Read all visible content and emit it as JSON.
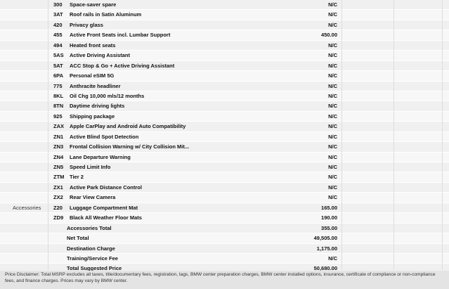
{
  "options": [
    {
      "category": "",
      "code": "300",
      "description": "Space-saver spare",
      "price": "N/C"
    },
    {
      "category": "",
      "code": "3AT",
      "description": "Roof rails in Satin Aluminum",
      "price": "N/C"
    },
    {
      "category": "",
      "code": "420",
      "description": "Privacy glass",
      "price": "N/C"
    },
    {
      "category": "",
      "code": "455",
      "description": "Active Front Seats incl. Lumbar Support",
      "price": "450.00"
    },
    {
      "category": "",
      "code": "494",
      "description": "Heated front seats",
      "price": "N/C"
    },
    {
      "category": "",
      "code": "5AS",
      "description": "Active Driving Assistant",
      "price": "N/C"
    },
    {
      "category": "",
      "code": "5AT",
      "description": "ACC Stop & Go + Active Driving Assistant",
      "price": "N/C"
    },
    {
      "category": "",
      "code": "6PA",
      "description": "Personal eSIM 5G",
      "price": "N/C"
    },
    {
      "category": "",
      "code": "775",
      "description": "Anthracite headliner",
      "price": "N/C"
    },
    {
      "category": "",
      "code": "8KL",
      "description": "Oil Chg 10,000 mls/12 months",
      "price": "N/C"
    },
    {
      "category": "",
      "code": "8TN",
      "description": "Daytime driving lights",
      "price": "N/C"
    },
    {
      "category": "",
      "code": "925",
      "description": "Shipping package",
      "price": "N/C"
    },
    {
      "category": "",
      "code": "ZAX",
      "description": "Apple CarPlay and Android Auto Compatibility",
      "price": "N/C"
    },
    {
      "category": "",
      "code": "ZN1",
      "description": "Active Blind Spot Detection",
      "price": "N/C"
    },
    {
      "category": "",
      "code": "ZN3",
      "description": "Frontal Collision Warning w/ City Collision Mit...",
      "price": "N/C"
    },
    {
      "category": "",
      "code": "ZN4",
      "description": "Lane Departure Warning",
      "price": "N/C"
    },
    {
      "category": "",
      "code": "ZN5",
      "description": "Speed Limit Info",
      "price": "N/C"
    },
    {
      "category": "",
      "code": "ZTM",
      "description": "Tier 2",
      "price": "N/C"
    },
    {
      "category": "",
      "code": "ZX1",
      "description": "Active Park Distance Control",
      "price": "N/C"
    },
    {
      "category": "",
      "code": "ZX2",
      "description": "Rear View Camera",
      "price": "N/C"
    },
    {
      "category": "Accessories",
      "code": "Z20",
      "description": "Luggage Compartment Mat",
      "price": "165.00"
    },
    {
      "category": "",
      "code": "ZD9",
      "description": "Black All Weather Floor Mats",
      "price": "190.00"
    }
  ],
  "totals": [
    {
      "label": "Accessories Total",
      "value": "355.00"
    },
    {
      "label": "Net Total",
      "value": "49,505.00"
    },
    {
      "label": "Destination Charge",
      "value": "1,175.00"
    },
    {
      "label": "Training/Service Fee",
      "value": "N/C"
    },
    {
      "label": "Total Suggested Price",
      "value": "50,680.00"
    }
  ],
  "disclaimer": "Price Disclaimer: Total MSRP excludes all taxes, title/documentary fees, registration, tags, BMW center preparation charges, BMW center installed options, insurance, certificate of compliance or non-compliance fees, and finance charges. Prices may vary by BMW center."
}
